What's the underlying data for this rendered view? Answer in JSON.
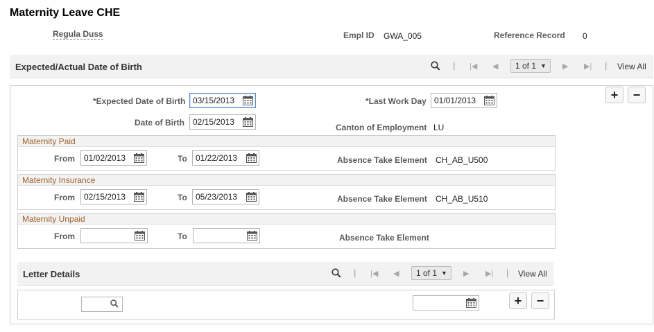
{
  "page": {
    "title": "Maternity Leave CHE"
  },
  "employee": {
    "name": "Regula Duss",
    "empl_id_label": "Empl ID",
    "empl_id": "GWA_005",
    "ref_label": "Reference Record",
    "ref_value": "0"
  },
  "birth_grid": {
    "title": "Expected/Actual Date of Birth",
    "count": "1 of 1",
    "view_all": "View All"
  },
  "birth": {
    "expected_label": "*Expected Date of Birth",
    "expected_value": "03/15/2013",
    "date_label": "Date of Birth",
    "date_value": "02/15/2013",
    "last_work_label": "*Last Work Day",
    "last_work_value": "01/01/2013",
    "canton_label": "Canton of Employment",
    "canton_value": "LU"
  },
  "groups": {
    "paid": {
      "title": "Maternity Paid",
      "from_label": "From",
      "from_value": "01/02/2013",
      "to_label": "To",
      "to_value": "01/22/2013",
      "element_label": "Absence Take Element",
      "element_value": "CH_AB_U500"
    },
    "insurance": {
      "title": "Maternity Insurance",
      "from_label": "From",
      "from_value": "02/15/2013",
      "to_label": "To",
      "to_value": "05/23/2013",
      "element_label": "Absence Take Element",
      "element_value": "CH_AB_U510"
    },
    "unpaid": {
      "title": "Maternity Unpaid",
      "from_label": "From",
      "from_value": "",
      "to_label": "To",
      "to_value": "",
      "element_label": "Absence Take Element",
      "element_value": ""
    }
  },
  "letter_grid": {
    "title": "Letter Details",
    "count": "1 of 1",
    "view_all": "View All",
    "search_value": "",
    "date_value": ""
  },
  "buttons": {
    "add": "+",
    "remove": "−"
  },
  "icons": {
    "search": "search-icon",
    "first": "first-page-icon",
    "prev": "previous-page-icon",
    "next": "next-page-icon",
    "last": "last-page-icon",
    "calendar": "calendar-icon",
    "dropdown": "chevron-down-icon"
  }
}
